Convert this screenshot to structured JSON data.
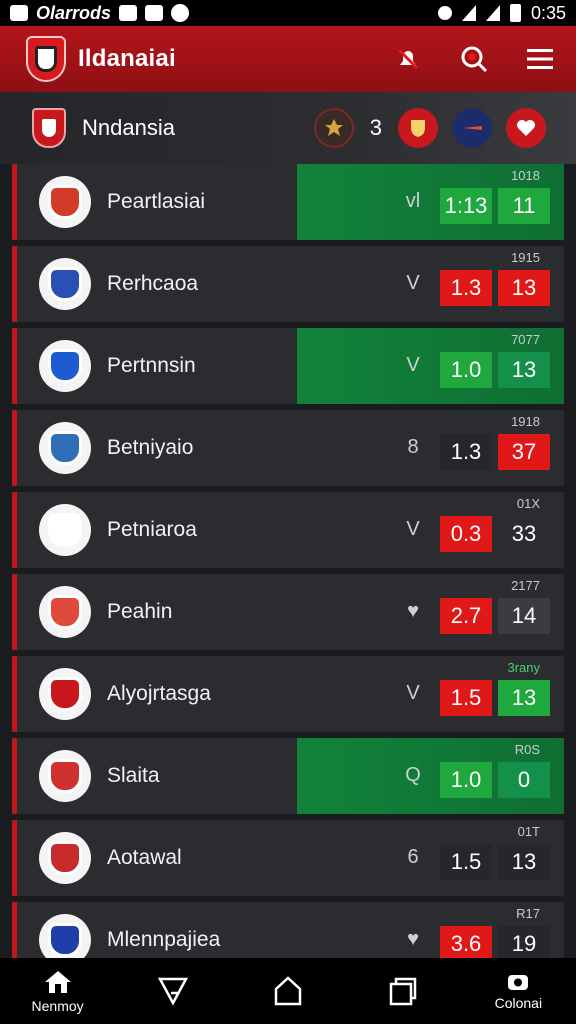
{
  "status_bar": {
    "carrier": "Olarrods",
    "time": "0:35"
  },
  "app_bar": {
    "title": "Ildanaiai"
  },
  "team_header": {
    "name": "Nndansia",
    "count": "3"
  },
  "rows": [
    {
      "name": "Peartlasiai",
      "mark": "vl",
      "tag": "1018",
      "odd1": "1:13",
      "odd2": "11",
      "style1": "green",
      "style2": "green",
      "highlight": true,
      "tag_green": false,
      "crest": "#d23a2a"
    },
    {
      "name": "Rerhcaoa",
      "mark": "V",
      "tag": "1915",
      "odd1": "1.3",
      "odd2": "13",
      "style1": "red",
      "style2": "red",
      "highlight": false,
      "tag_green": false,
      "crest": "#2a4fb5"
    },
    {
      "name": "Pertnnsin",
      "mark": "V",
      "tag": "7077",
      "odd1": "1.0",
      "odd2": "13",
      "style1": "green",
      "style2": "teal",
      "highlight": true,
      "tag_green": false,
      "crest": "#1d5bd1"
    },
    {
      "name": "Betniyaio",
      "mark": "8",
      "tag": "1918",
      "odd1": "1.3",
      "odd2": "37",
      "style1": "dark",
      "style2": "red",
      "highlight": false,
      "tag_green": false,
      "crest": "#2e6fb8"
    },
    {
      "name": "Petniaroa",
      "mark": "V",
      "tag": "01X",
      "odd1": "0.3",
      "odd2": "33",
      "style1": "red",
      "style2": "none",
      "highlight": false,
      "tag_green": false,
      "crest": "#ffffff"
    },
    {
      "name": "Peahin",
      "mark": "♥",
      "tag": "2177",
      "odd1": "2.7",
      "odd2": "14",
      "style1": "red",
      "style2": "gray",
      "highlight": false,
      "tag_green": false,
      "crest": "#e04a3a"
    },
    {
      "name": "Alyojrtasga",
      "mark": "V",
      "tag": "3rany",
      "odd1": "1.5",
      "odd2": "13",
      "style1": "red",
      "style2": "green",
      "highlight": false,
      "tag_green": true,
      "crest": "#c8181e"
    },
    {
      "name": "Slaita",
      "mark": "Q",
      "tag": "R0S",
      "odd1": "1.0",
      "odd2": "0",
      "style1": "green",
      "style2": "teal",
      "highlight": true,
      "tag_green": false,
      "crest": "#d03030"
    },
    {
      "name": "Aotawal",
      "mark": "6",
      "tag": "01T",
      "odd1": "1.5",
      "odd2": "13",
      "style1": "dark",
      "style2": "dark",
      "highlight": false,
      "tag_green": false,
      "crest": "#c82b2b"
    },
    {
      "name": "Mlennpajiea",
      "mark": "♥",
      "tag": "R17",
      "odd1": "3.6",
      "odd2": "19",
      "style1": "red",
      "style2": "dark",
      "highlight": false,
      "tag_green": false,
      "crest": "#1f3fa8"
    }
  ],
  "nav": {
    "home": "Nenmoy",
    "profile": "Colonai"
  },
  "colors": {
    "brand_red": "#b3151b",
    "odd_green": "#1fa83d",
    "odd_red": "#e01818"
  }
}
